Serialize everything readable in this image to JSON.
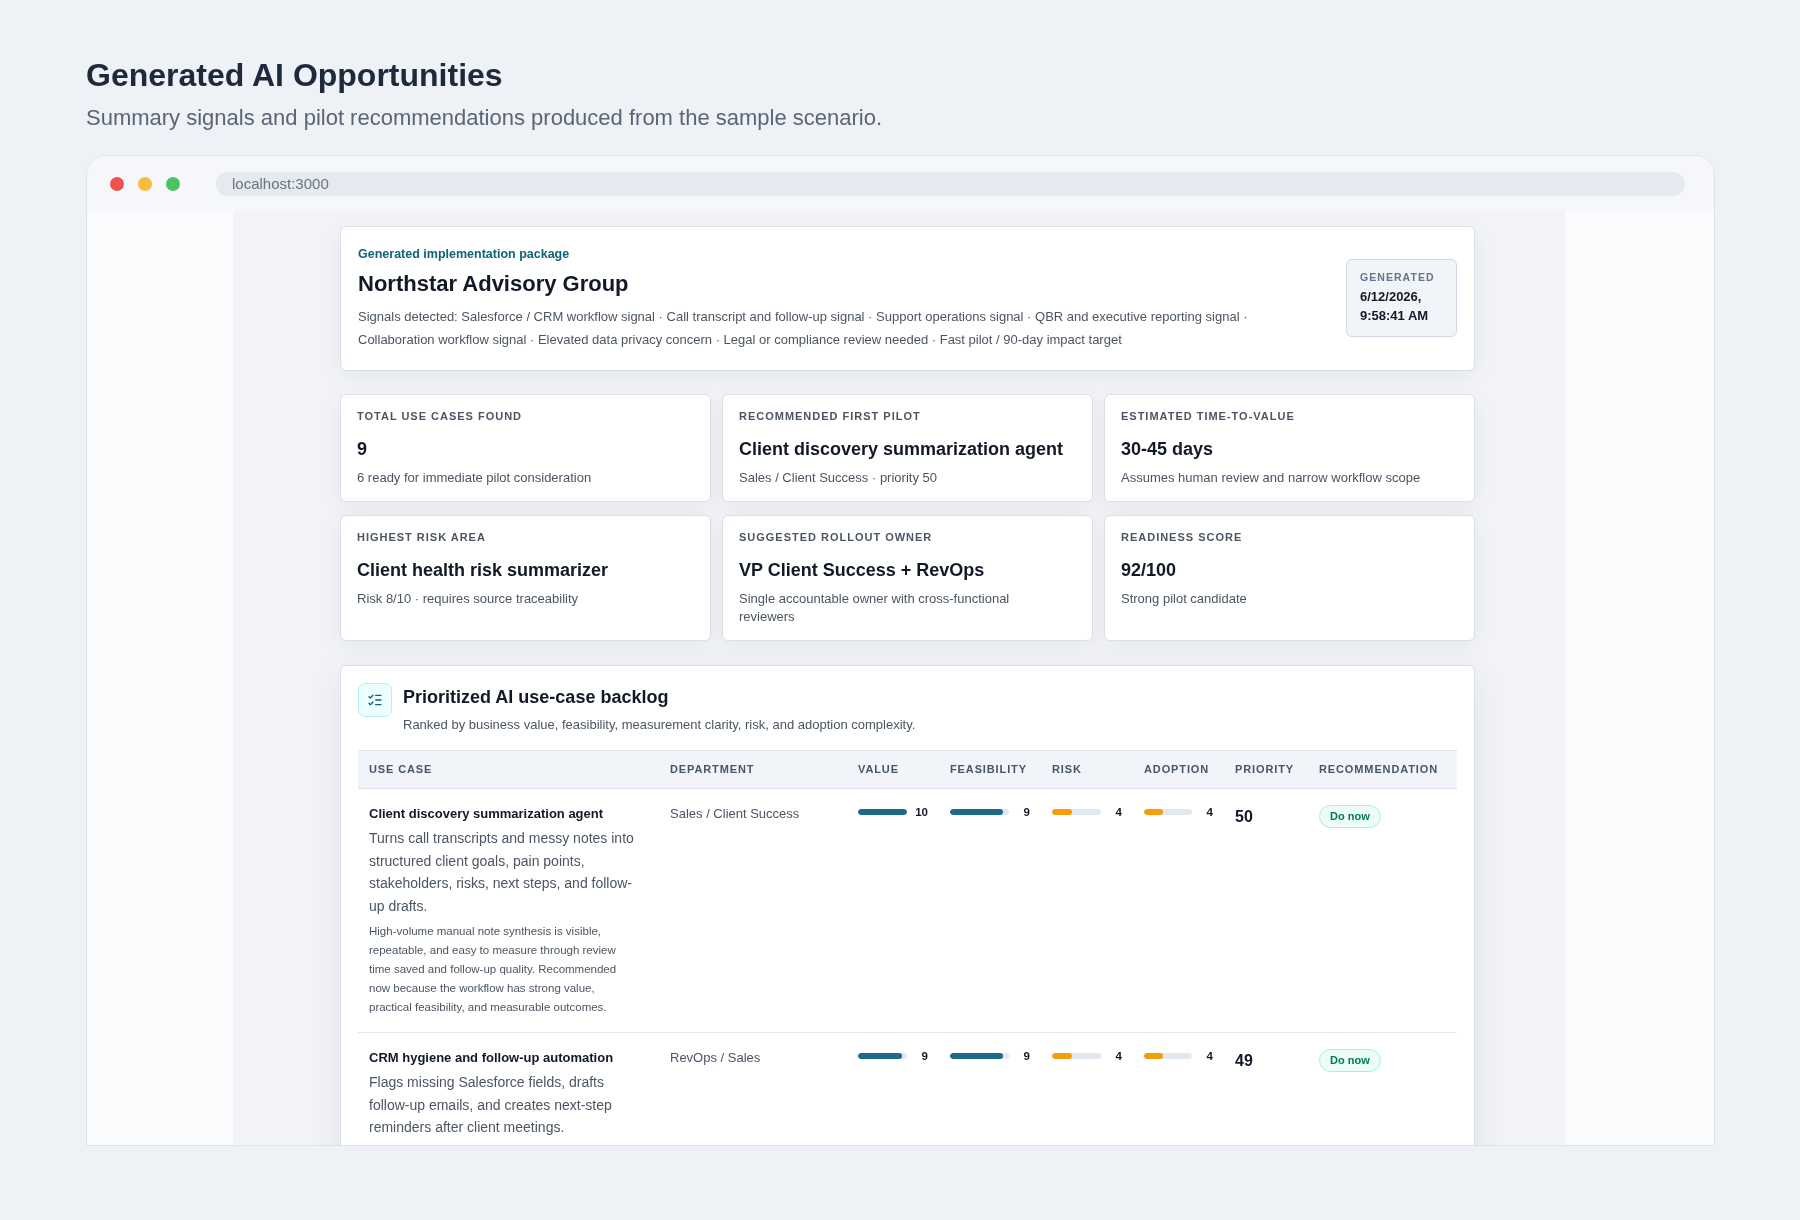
{
  "page": {
    "title": "Generated AI Opportunities",
    "subtitle": "Summary signals and pilot recommendations produced from the sample scenario."
  },
  "browser": {
    "url": "localhost:3000"
  },
  "summary": {
    "eyebrow": "Generated implementation package",
    "title": "Northstar Advisory Group",
    "signals": "Signals detected: Salesforce / CRM workflow signal · Call transcript and follow-up signal · Support operations signal · QBR and executive reporting signal · Collaboration workflow signal · Elevated data privacy concern · Legal or compliance review needed · Fast pilot / 90-day impact target",
    "generated": {
      "label": "GENERATED",
      "value": "6/12/2026, 9:58:41 AM"
    }
  },
  "stats": [
    {
      "label": "TOTAL USE CASES FOUND",
      "value": "9",
      "note": "6 ready for immediate pilot consideration"
    },
    {
      "label": "RECOMMENDED FIRST PILOT",
      "value": "Client discovery summarization agent",
      "note": "Sales / Client Success · priority 50"
    },
    {
      "label": "ESTIMATED TIME-TO-VALUE",
      "value": "30-45 days",
      "note": "Assumes human review and narrow workflow scope"
    },
    {
      "label": "HIGHEST RISK AREA",
      "value": "Client health risk summarizer",
      "note": "Risk 8/10 · requires source traceability"
    },
    {
      "label": "SUGGESTED ROLLOUT OWNER",
      "value": "VP Client Success + RevOps",
      "note": "Single accountable owner with cross-functional reviewers"
    },
    {
      "label": "READINESS SCORE",
      "value": "92/100",
      "note": "Strong pilot candidate"
    }
  ],
  "backlog": {
    "title": "Prioritized AI use-case backlog",
    "subtitle": "Ranked by business value, feasibility, measurement clarity, risk, and adoption complexity.",
    "table": {
      "columns": [
        {
          "label": "USE CASE",
          "kind": "use_case"
        },
        {
          "label": "DEPARTMENT",
          "kind": "department"
        },
        {
          "label": "VALUE",
          "kind": "score",
          "color": "#1b6b88"
        },
        {
          "label": "FEASIBILITY",
          "kind": "score",
          "color": "#1b6b88"
        },
        {
          "label": "RISK",
          "kind": "score",
          "color": "#f59e0b"
        },
        {
          "label": "ADOPTION",
          "kind": "score",
          "color": "#f59e0b"
        },
        {
          "label": "PRIORITY",
          "kind": "priority"
        },
        {
          "label": "RECOMMENDATION",
          "kind": "recommendation"
        }
      ],
      "rows": [
        {
          "title": "Client discovery summarization agent",
          "description": "Turns call transcripts and messy notes into structured client goals, pain points, stakeholders, risks, next steps, and follow-up drafts.",
          "rationale": "High-volume manual note synthesis is visible, repeatable, and easy to measure through review time saved and follow-up quality. Recommended now because the workflow has strong value, practical feasibility, and measurable outcomes.",
          "department": "Sales / Client Success",
          "scores": [
            {
              "value": "10",
              "level": 1
            },
            {
              "value": "9",
              "level": 0.9
            },
            {
              "value": "4",
              "level": 0.4
            },
            {
              "value": "4",
              "level": 0.4
            }
          ],
          "priority": "50",
          "recommendation": "Do now"
        },
        {
          "title": "CRM hygiene and follow-up automation",
          "description": "Flags missing Salesforce fields, drafts follow-up emails, and creates next-step reminders after client meetings.",
          "department": "RevOps / Sales",
          "scores": [
            {
              "value": "9",
              "level": 0.9
            },
            {
              "value": "9",
              "level": 0.9
            },
            {
              "value": "4",
              "level": 0.4
            },
            {
              "value": "4",
              "level": 0.4
            }
          ],
          "priority": "49",
          "recommendation": "Do now"
        }
      ]
    }
  }
}
